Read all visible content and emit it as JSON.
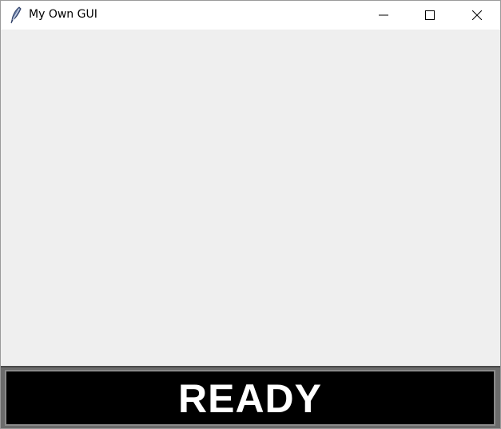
{
  "window": {
    "title": "My Own GUI",
    "app_icon": "tk-feather-icon",
    "controls": {
      "minimize_icon": "minimize-icon",
      "maximize_icon": "maximize-icon",
      "close_icon": "close-icon"
    }
  },
  "status": {
    "text": "READY",
    "background_color": "#000000",
    "text_color": "#ffffff"
  },
  "colors": {
    "client_background": "#efefef",
    "titlebar_background": "#ffffff"
  }
}
